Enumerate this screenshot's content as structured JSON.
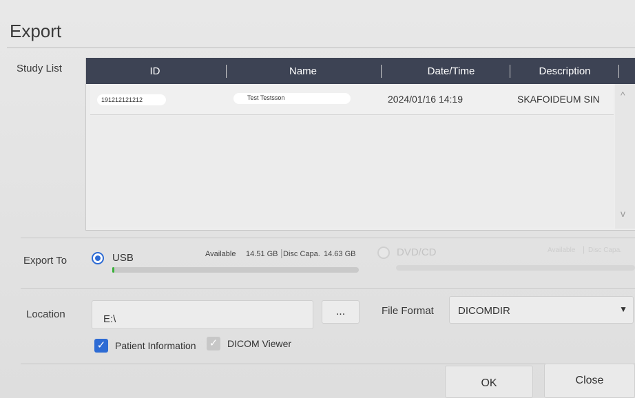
{
  "dialog": {
    "title": "Export"
  },
  "study_list": {
    "label": "Study List",
    "columns": [
      "ID",
      "Name",
      "Date/Time",
      "Description"
    ],
    "rows": [
      {
        "id": "191212121212",
        "name": "Test Testsson",
        "datetime": "2024/01/16 14:19",
        "description": "SKAFOIDEUM SIN"
      }
    ],
    "scroll_up_glyph": "^",
    "scroll_down_glyph": "v"
  },
  "export_to": {
    "label": "Export To",
    "usb": {
      "label": "USB",
      "selected": true,
      "available_label": "Available",
      "available_value": "14.51 GB",
      "capacity_label": "Disc Capa.",
      "capacity_value": "14.63 GB",
      "used_fraction": 0.008
    },
    "dvd": {
      "label": "DVD/CD",
      "selected": false,
      "enabled": false,
      "available_label": "Available",
      "capacity_label": "Disc Capa."
    }
  },
  "location": {
    "label": "Location",
    "value": "E:\\",
    "browse_label": "..."
  },
  "file_format": {
    "label": "File Format",
    "value": "DICOMDIR"
  },
  "options": {
    "patient_information": {
      "label": "Patient Information",
      "checked": true
    },
    "dicom_viewer": {
      "label": "DICOM Viewer",
      "checked": true,
      "enabled": false
    }
  },
  "actions": {
    "ok_label": "OK",
    "close_label": "Close"
  },
  "colors": {
    "header": "#3d4354",
    "accent": "#2d6bd4",
    "progress": "#3bb13b"
  }
}
